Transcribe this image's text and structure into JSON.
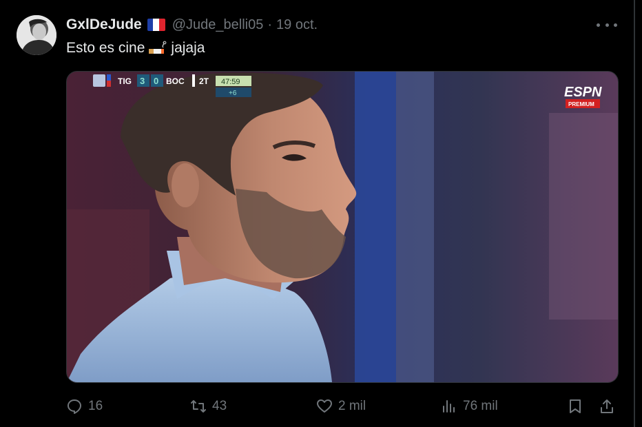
{
  "author": {
    "display_name": "GxlDeJude",
    "handle": "@Jude_belli05",
    "separator": "·",
    "timestamp": "19 oct.",
    "flag_icon": "france-flag-icon"
  },
  "tweet": {
    "text_before": "Esto es cine",
    "emoji_icon": "cigarette-icon",
    "text_after": "jajaja"
  },
  "media": {
    "scoreboard": {
      "home_team": "TIG",
      "home_score": "3",
      "away_score": "0",
      "away_team": "BOC",
      "period": "2T",
      "clock": "47:59",
      "added_time": "+6"
    },
    "broadcaster": {
      "logo": "ESPN",
      "sub_label": "PREMIUM"
    }
  },
  "actions": {
    "replies": "16",
    "reposts": "43",
    "likes": "2 mil",
    "views": "76 mil"
  },
  "colors": {
    "background": "#000000",
    "text_primary": "#e7e9ea",
    "text_secondary": "#71767b",
    "border": "#2f3336"
  }
}
